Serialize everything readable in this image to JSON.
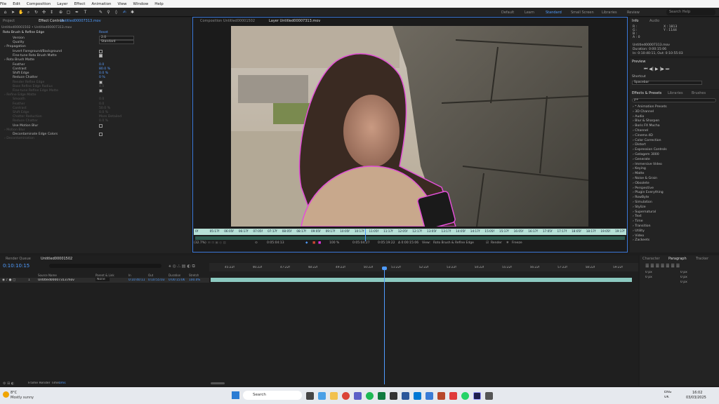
{
  "menu": [
    "File",
    "Edit",
    "Composition",
    "Layer",
    "Effect",
    "Animation",
    "View",
    "Window",
    "Help"
  ],
  "workspaces": [
    {
      "label": "Default",
      "active": false
    },
    {
      "label": "Learn",
      "active": false
    },
    {
      "label": "Standard",
      "active": true
    },
    {
      "label": "Small Screen",
      "active": false
    },
    {
      "label": "Libraries",
      "active": false
    },
    {
      "label": "Review",
      "active": false
    }
  ],
  "search_help": "Search Help",
  "project_tab": "Project",
  "effect_controls": {
    "tab": "Effect Controls",
    "tab_layer": "Untitled00007313.mov",
    "breadcrumb": "Untitled00001502 • Untitled00007313.mov",
    "effect_name": "Roto Brush & Refine Edge",
    "reset": "Reset",
    "rows": [
      {
        "label": "Version",
        "value": "2.0",
        "kind": "dropdown"
      },
      {
        "label": "Quality",
        "value": "Standard",
        "kind": "dropdown"
      },
      {
        "label": "Propagation",
        "value": "",
        "kind": "group"
      },
      {
        "label": "Invert Foreground/Background",
        "value": "",
        "kind": "checkbox",
        "checked": false
      },
      {
        "label": "Fine-tune Roto Brush Matte",
        "value": "",
        "kind": "checkbox",
        "checked": true
      },
      {
        "label": "Roto Brush Matte",
        "value": "",
        "kind": "group"
      },
      {
        "label": "Feather",
        "value": "0.0",
        "kind": "number"
      },
      {
        "label": "Contrast",
        "value": "80.0 %",
        "kind": "number"
      },
      {
        "label": "Shift Edge",
        "value": "0.0 %",
        "kind": "number"
      },
      {
        "label": "Reduce Chatter",
        "value": "0 %",
        "kind": "number"
      },
      {
        "label": "Render Refine Edge",
        "value": "",
        "kind": "checkbox-dim",
        "checked": true
      },
      {
        "label": "Base Refine Edge Radius",
        "value": "4.0",
        "kind": "number-dim"
      },
      {
        "label": "Fine-tune Refine Edge Matte",
        "value": "",
        "kind": "checkbox-dim",
        "checked": true
      },
      {
        "label": "Refine Edge Matte",
        "value": "",
        "kind": "group-dim"
      },
      {
        "label": "Smooth",
        "value": "0.0",
        "kind": "number-dim"
      },
      {
        "label": "Feather",
        "value": "0.0",
        "kind": "number-dim"
      },
      {
        "label": "Contrast",
        "value": "50.0 %",
        "kind": "number-dim"
      },
      {
        "label": "Shift Edge",
        "value": "0.0 %",
        "kind": "number-dim"
      },
      {
        "label": "Chatter Reduction",
        "value": "More Detailed",
        "kind": "number-dim"
      },
      {
        "label": "Reduce Chatter",
        "value": "0.0 %",
        "kind": "number-dim"
      },
      {
        "label": "Use Motion Blur",
        "value": "",
        "kind": "checkbox",
        "checked": false
      },
      {
        "label": "Motion Blur",
        "value": "",
        "kind": "group-dim"
      },
      {
        "label": "Decontaminate Edge Colors",
        "value": "",
        "kind": "checkbox",
        "checked": false
      },
      {
        "label": "Decontamination",
        "value": "",
        "kind": "group-dim"
      }
    ]
  },
  "viewer": {
    "comp_tab": "Composition  Untitled00001502",
    "layer_tab": "Layer  Untitled00007313.mov",
    "ruler_labels": [
      "0f",
      "05:17f",
      "06:05f",
      "06:17f",
      "07:05f",
      "07:17f",
      "08:05f",
      "08:17f",
      "09:05f",
      "09:17f",
      "10:05f",
      "10:17f",
      "11:05f",
      "11:17f",
      "12:05f",
      "12:17f",
      "13:05f",
      "13:17f",
      "14:05f",
      "14:17f",
      "15:05f",
      "15:17f",
      "16:05f",
      "16:17f",
      "17:05f",
      "17:17f",
      "18:05f",
      "18:17f",
      "19:05f",
      "19:17f"
    ],
    "controls": {
      "mag": "(32.7%)",
      "timecode": "0:05:04:13",
      "color_value": "100 %",
      "tc_in": "0:05:04:27",
      "tc_out": "0:05:19:22",
      "duration": "Δ 0:00:15:06",
      "view_label": "View:",
      "view_value": "Roto Brush & Refine Edge",
      "render_label": "Render",
      "freeze_label": "Freeze"
    }
  },
  "info_panel": {
    "tab": "Info",
    "audio_tab": "Audio",
    "x": "X : 1813",
    "y": "Y : 1144",
    "r": "R :",
    "g": "G :",
    "b": "B :",
    "a": "A : 0",
    "file": "Untitled00007313.mov",
    "duration": "Duration: 0:00:15:06",
    "inout": "In: 0:10:40:11, Out: 0:10:55:03"
  },
  "preview_panel": {
    "title": "Preview",
    "shortcut_label": "Shortcut",
    "shortcut_value": "Spacebar"
  },
  "effects_presets": {
    "tab": "Effects & Presets",
    "libraries_tab": "Libraries",
    "brushes_tab": "Brushes",
    "search_placeholder": "ρ+",
    "items": [
      "* Animation Presets",
      "3D Channel",
      "Audio",
      "Blur & Sharpen",
      "Boris FX Mocha",
      "Channel",
      "Cinema 4D",
      "Color Correction",
      "Distort",
      "Expression Controls",
      "Gatagem 3000",
      "Generate",
      "Immersive Video",
      "Keying",
      "Matte",
      "Noise & Grain",
      "Obsolete",
      "Perspective",
      "Plugin Everything",
      "RowByte",
      "Simulation",
      "Stylize",
      "Supernatural",
      "Text",
      "Time",
      "Transition",
      "Utility",
      "Video",
      "Zackeets"
    ]
  },
  "character_panel": {
    "character_tab": "Character",
    "paragraph_tab": "Paragraph",
    "tracker_tab": "Tracker",
    "values": [
      "0 px",
      "0 px",
      "0 px",
      "0 px",
      "0 px"
    ]
  },
  "timeline": {
    "render_queue_tab": "Render Queue",
    "comp_tab": "Untitled00001502",
    "current_time": "0:10:10:15",
    "columns": {
      "source": "Source Name",
      "parent": "Parent & Link",
      "in": "In",
      "out": "Out",
      "duration": "Duration",
      "stretch": "Stretch"
    },
    "layer": {
      "index": "1",
      "name": "Untitled00007313.mov",
      "parent": "None",
      "in": "0:10:40:11",
      "out": "0:10:55:03",
      "duration": "0:00:15:06",
      "stretch": "100.0%"
    },
    "ruler_labels": [
      "45:22f",
      "46:22f",
      "47:22f",
      "48:22f",
      "49:22f",
      "50:22f",
      "51:22f",
      "52:22f",
      "53:22f",
      "54:22f",
      "55:22f",
      "56:22f",
      "57:22f",
      "58:22f",
      "59:22f"
    ],
    "frame_render_label": "Frame Render Time:",
    "frame_render_value": "0ms"
  },
  "taskbar": {
    "weather_temp": "8°C",
    "weather_desc": "Mostly sunny",
    "search": "Search",
    "lang": "ENG",
    "region": "UK",
    "time": "16:02",
    "date": "03/03/2025"
  },
  "colors": {
    "accent": "#4f9cff",
    "panel": "#232323",
    "viewer_border": "#3a77d8",
    "ruler": "#b6e0d6",
    "timeline_bar": "#8cc9c0"
  }
}
